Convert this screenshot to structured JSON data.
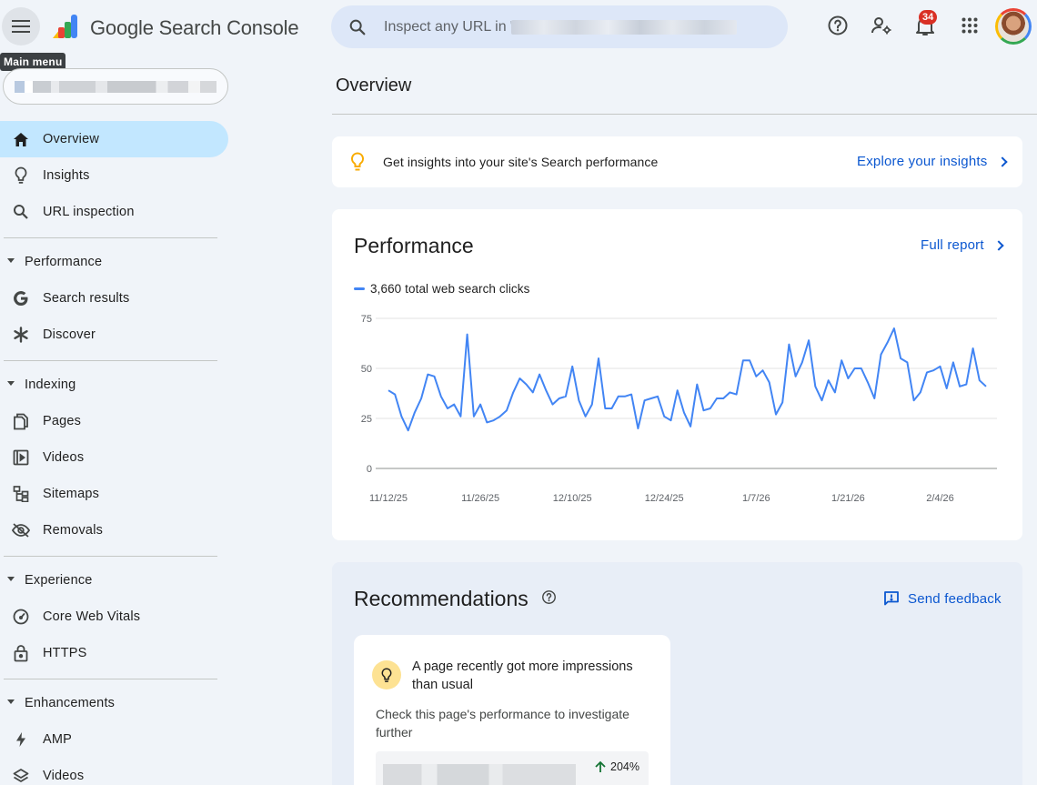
{
  "app": {
    "title": "Google Search Console",
    "menu_tooltip": "Main menu"
  },
  "header": {
    "search_placeholder": "Inspect any URL in \"",
    "notification_count": "34"
  },
  "sidebar": {
    "top_items": [
      {
        "label": "Overview",
        "icon": "home-icon",
        "active": true
      },
      {
        "label": "Insights",
        "icon": "lightbulb-icon"
      },
      {
        "label": "URL inspection",
        "icon": "search-icon"
      }
    ],
    "sections": [
      {
        "label": "Performance",
        "items": [
          {
            "label": "Search results",
            "icon": "google-g-icon"
          },
          {
            "label": "Discover",
            "icon": "asterisk-icon"
          }
        ]
      },
      {
        "label": "Indexing",
        "items": [
          {
            "label": "Pages",
            "icon": "pages-icon"
          },
          {
            "label": "Videos",
            "icon": "video-page-icon"
          },
          {
            "label": "Sitemaps",
            "icon": "sitemap-icon"
          },
          {
            "label": "Removals",
            "icon": "eye-off-icon"
          }
        ]
      },
      {
        "label": "Experience",
        "items": [
          {
            "label": "Core Web Vitals",
            "icon": "speedometer-icon"
          },
          {
            "label": "HTTPS",
            "icon": "lock-icon"
          }
        ]
      },
      {
        "label": "Enhancements",
        "items": [
          {
            "label": "AMP",
            "icon": "bolt-icon"
          },
          {
            "label": "Videos",
            "icon": "layers-icon"
          }
        ]
      }
    ]
  },
  "main": {
    "page_title": "Overview",
    "insight_banner": {
      "text": "Get insights into your site's Search performance",
      "link": "Explore your insights"
    },
    "performance": {
      "title": "Performance",
      "link": "Full report",
      "legend": "3,660 total web search clicks"
    },
    "recommendations": {
      "title": "Recommendations",
      "feedback": "Send feedback",
      "card": {
        "headline": "A page recently got more impressions than usual",
        "body": "Check this page's performance to investigate further",
        "change": "204%"
      }
    }
  },
  "colors": {
    "accent": "#0b57d0",
    "line": "#4285f4",
    "active_nav": "#c2e7ff",
    "background": "#f0f4f9"
  },
  "chart_data": {
    "type": "line",
    "series": [
      {
        "name": "3,660 total web search clicks",
        "values": [
          39,
          37,
          26,
          19,
          28,
          35,
          47,
          46,
          36,
          30,
          32,
          26,
          67,
          26,
          32,
          23,
          24,
          26,
          29,
          38,
          45,
          42,
          38,
          47,
          39,
          32,
          35,
          36,
          51,
          34,
          26,
          32,
          55,
          30,
          30,
          36,
          36,
          37,
          20,
          34,
          35,
          36,
          26,
          24,
          39,
          28,
          21,
          42,
          29,
          30,
          35,
          35,
          38,
          37,
          54,
          54,
          46,
          49,
          43,
          27,
          33,
          62,
          46,
          53,
          64,
          41,
          34,
          44,
          38,
          54,
          45,
          50,
          50,
          43,
          35,
          57,
          63,
          70,
          55,
          53,
          34,
          38,
          48,
          49,
          51,
          40,
          53,
          41,
          42,
          60,
          44,
          41
        ]
      }
    ],
    "x_tick_labels": [
      "11/12/25",
      "11/26/25",
      "12/10/25",
      "12/24/25",
      "1/7/26",
      "1/21/26",
      "2/4/26"
    ],
    "y_tick_labels": [
      "0",
      "25",
      "50",
      "75"
    ],
    "ylim": [
      0,
      75
    ],
    "grid": true
  }
}
